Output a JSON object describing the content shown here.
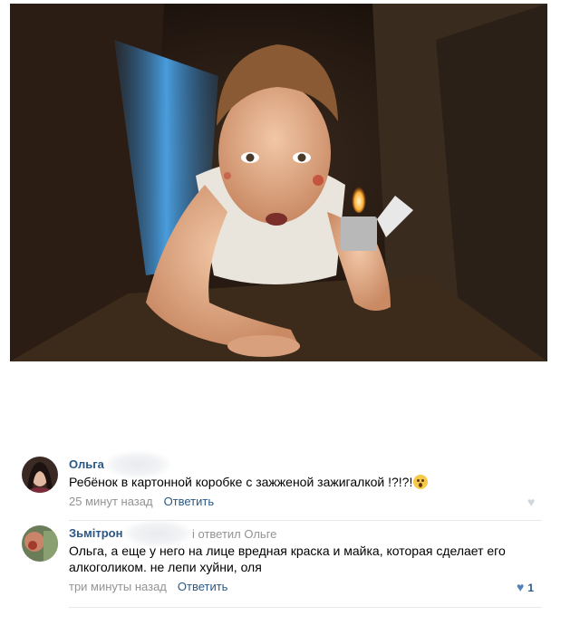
{
  "comments": [
    {
      "author": "Ольга",
      "text": "Ребёнок в картонной коробке с зажженой зажигалкой !?!?!",
      "emoji": "surprised-face",
      "time": "25 минут назад",
      "reply_label": "Ответить"
    },
    {
      "author": "Зьмітрон",
      "replied_to": "і ответил Ольге",
      "text": "Ольга, а еще у него на лице вредная краска и майка, которая сделает его алкоголиком. не лепи хуйни, оля",
      "time": "три минуты назад",
      "reply_label": "Ответить",
      "likes": "1"
    }
  ],
  "colors": {
    "link": "#2a5885",
    "meta": "#939393",
    "like_active": "#5181b8"
  }
}
